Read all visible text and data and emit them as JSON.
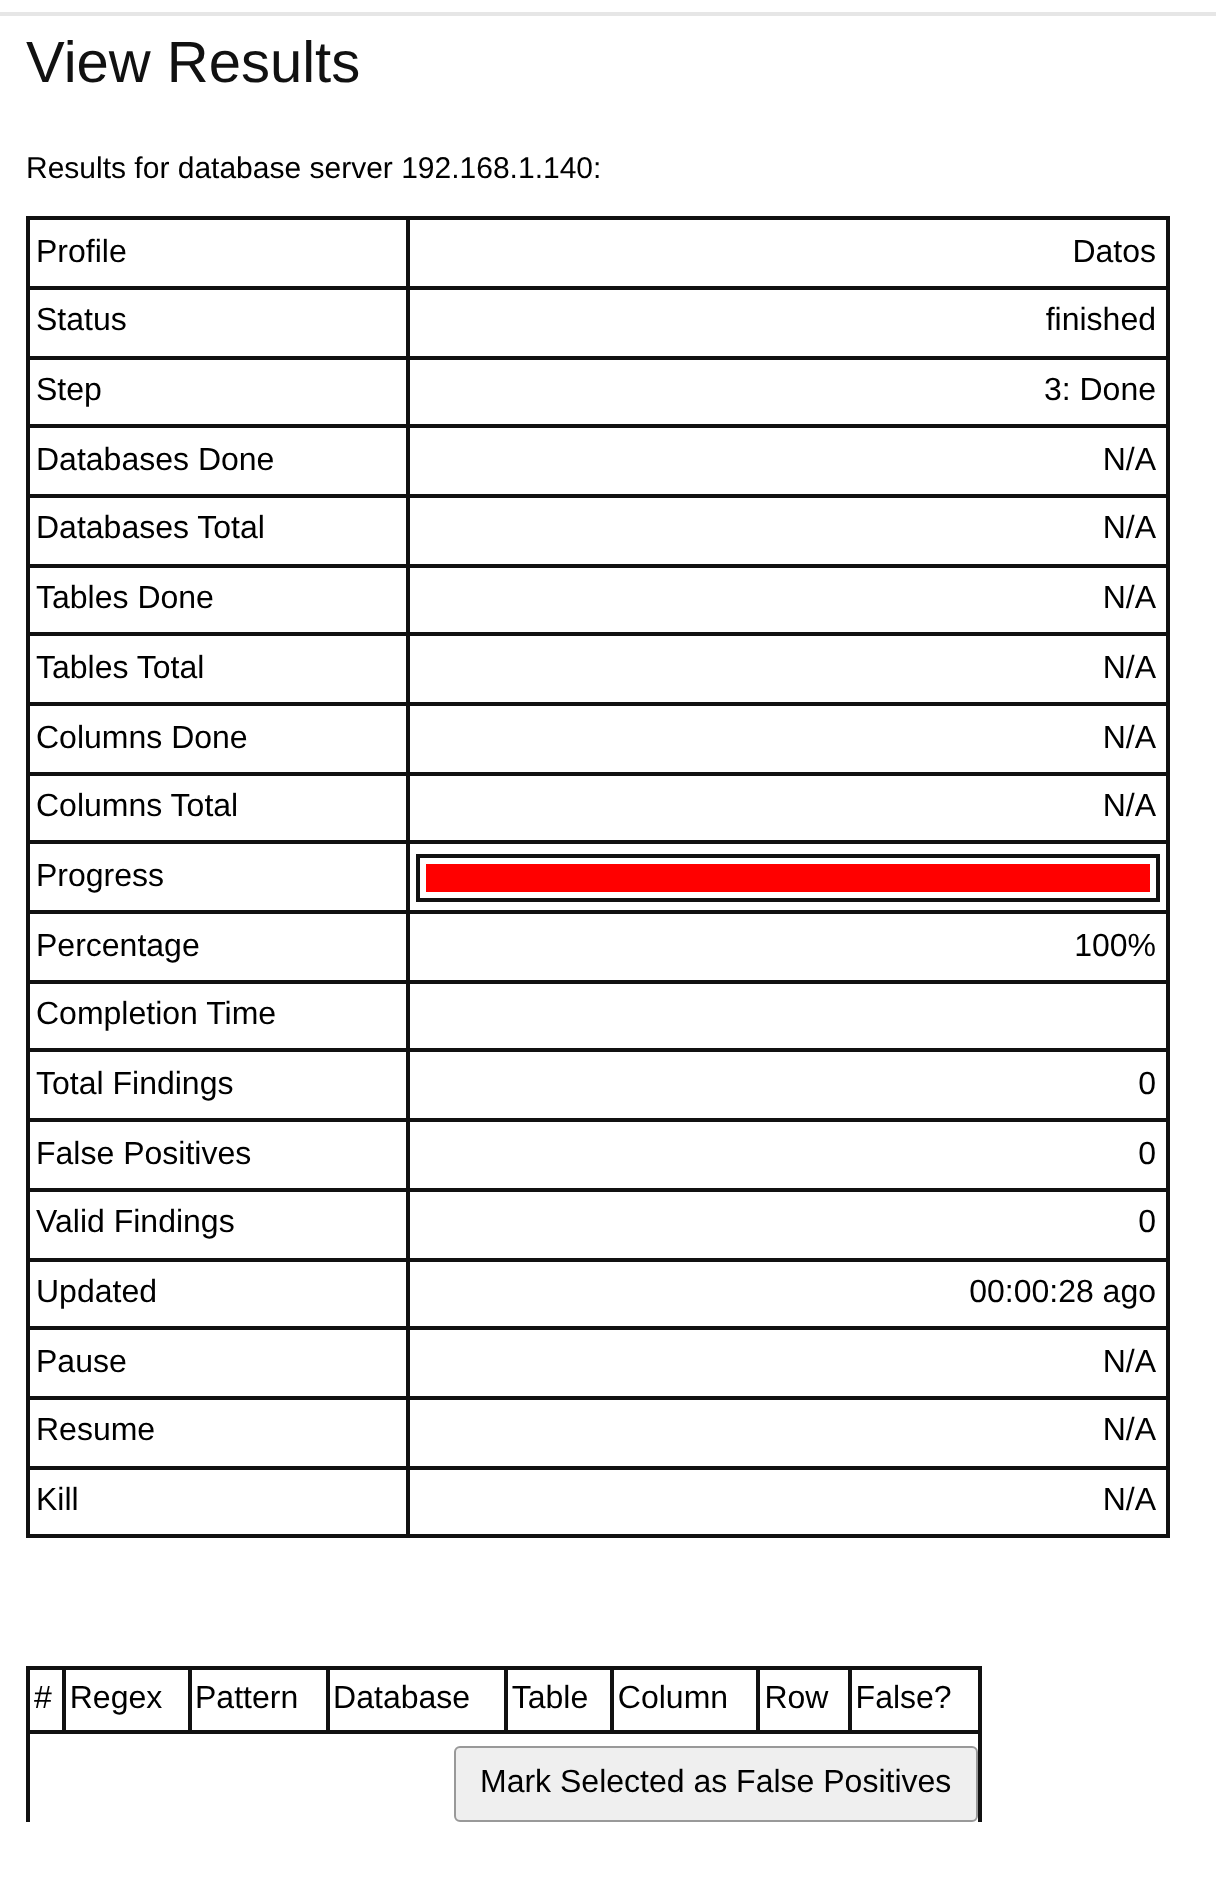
{
  "title": "View Results",
  "subtitle": "Results for database server 192.168.1.140:",
  "summary": [
    {
      "kind": "text",
      "label": "Profile",
      "value": "Datos"
    },
    {
      "kind": "text",
      "label": "Status",
      "value": "finished"
    },
    {
      "kind": "text",
      "label": "Step",
      "value": "3: Done"
    },
    {
      "kind": "text",
      "label": "Databases Done",
      "value": "N/A"
    },
    {
      "kind": "text",
      "label": "Databases Total",
      "value": "N/A"
    },
    {
      "kind": "text",
      "label": "Tables Done",
      "value": "N/A"
    },
    {
      "kind": "text",
      "label": "Tables Total",
      "value": "N/A"
    },
    {
      "kind": "text",
      "label": "Columns Done",
      "value": "N/A"
    },
    {
      "kind": "text",
      "label": "Columns Total",
      "value": "N/A"
    },
    {
      "kind": "progress",
      "label": "Progress",
      "level": 1
    },
    {
      "kind": "text",
      "label": "Percentage",
      "value": "100%"
    },
    {
      "kind": "text",
      "label": "Completion Time"
    },
    {
      "kind": "text",
      "label": "Total Findings",
      "value": "0"
    },
    {
      "kind": "text",
      "label": "False Positives",
      "value": "0"
    },
    {
      "kind": "text",
      "label": "Valid Findings",
      "value": "0"
    },
    {
      "kind": "text",
      "label": "Updated",
      "value": "00:00:28 ago"
    },
    {
      "kind": "text",
      "label": "Pause",
      "value": "N/A"
    },
    {
      "kind": "text",
      "label": "Resume",
      "value": "N/A"
    },
    {
      "kind": "text",
      "label": "Kill",
      "value": "N/A"
    }
  ],
  "findings": {
    "columns": [
      "#",
      "Regex",
      "Pattern",
      "Database",
      "Table",
      "Column",
      "Row",
      "False?"
    ],
    "button": "Mark Selected as False Positives"
  }
}
